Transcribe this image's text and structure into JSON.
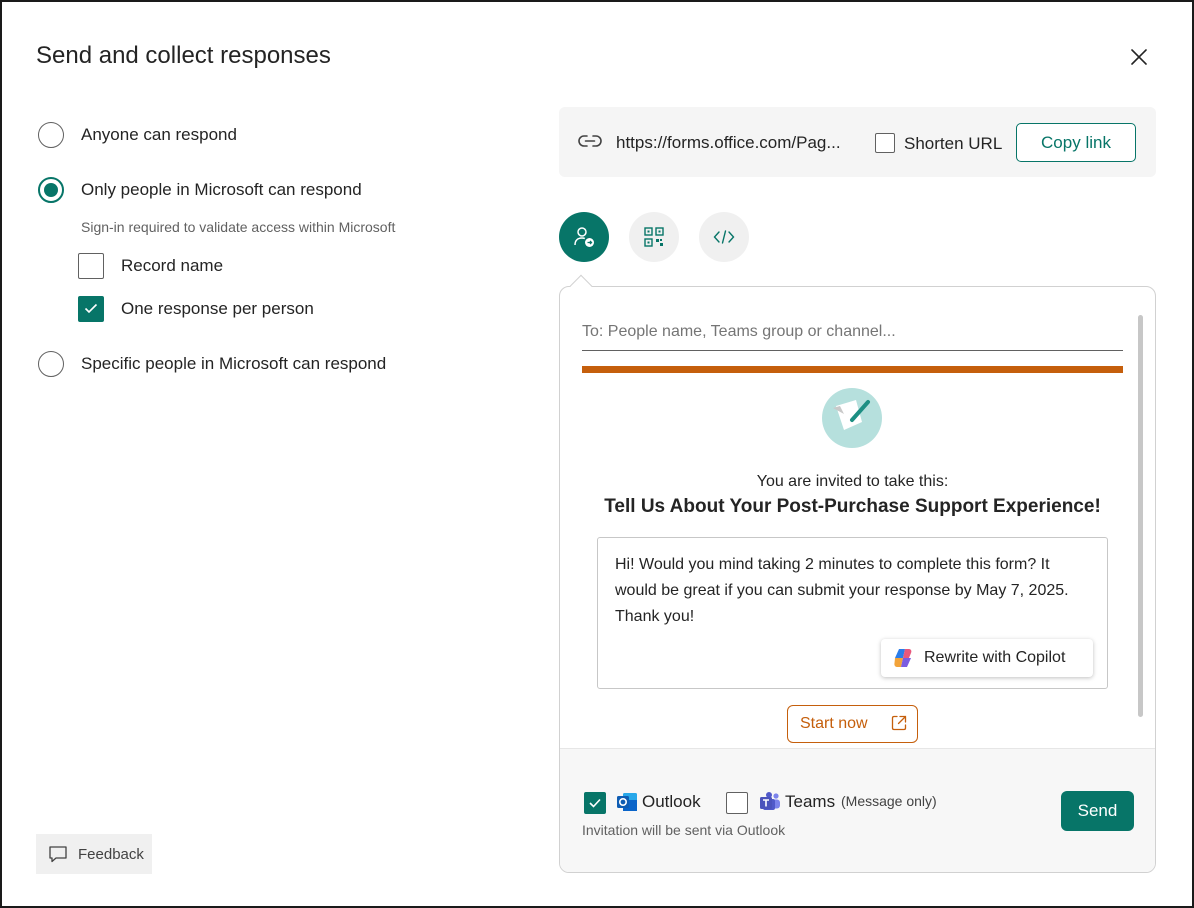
{
  "dialog": {
    "title": "Send and collect responses"
  },
  "access": {
    "options": [
      {
        "label": "Anyone can respond",
        "selected": false
      },
      {
        "label": "Only people in Microsoft can respond",
        "selected": true
      },
      {
        "label": "Specific people in Microsoft can respond",
        "selected": false
      }
    ],
    "note": "Sign-in required to validate access within Microsoft",
    "record_name": {
      "label": "Record name",
      "checked": false
    },
    "one_response": {
      "label": "One response per person",
      "checked": true
    }
  },
  "feedback": {
    "label": "Feedback"
  },
  "link": {
    "url": "https://forms.office.com/Pag...",
    "shorten_label": "Shorten URL",
    "shorten_checked": false,
    "copy_label": "Copy link"
  },
  "share_modes": [
    {
      "icon": "person-send-icon",
      "active": true
    },
    {
      "icon": "qr-code-icon",
      "active": false
    },
    {
      "icon": "embed-code-icon",
      "active": false
    }
  ],
  "invite": {
    "to_placeholder": "To: People name, Teams group or channel...",
    "invited_text": "You are invited to take this:",
    "form_title": "Tell Us About Your Post-Purchase Support Experience!",
    "message": "Hi! Would you mind taking 2 minutes to complete this form? It would be great if you can submit your response by May 7, 2025. Thank you!",
    "copilot_label": "Rewrite with Copilot",
    "start_label": "Start now"
  },
  "send": {
    "outlook_label": "Outlook",
    "outlook_checked": true,
    "teams_label": "Teams",
    "teams_checked": false,
    "teams_note": "(Message only)",
    "note": "Invitation will be sent via Outlook",
    "send_label": "Send"
  },
  "colors": {
    "accent": "#077568",
    "brand_orange": "#c55f0c"
  }
}
